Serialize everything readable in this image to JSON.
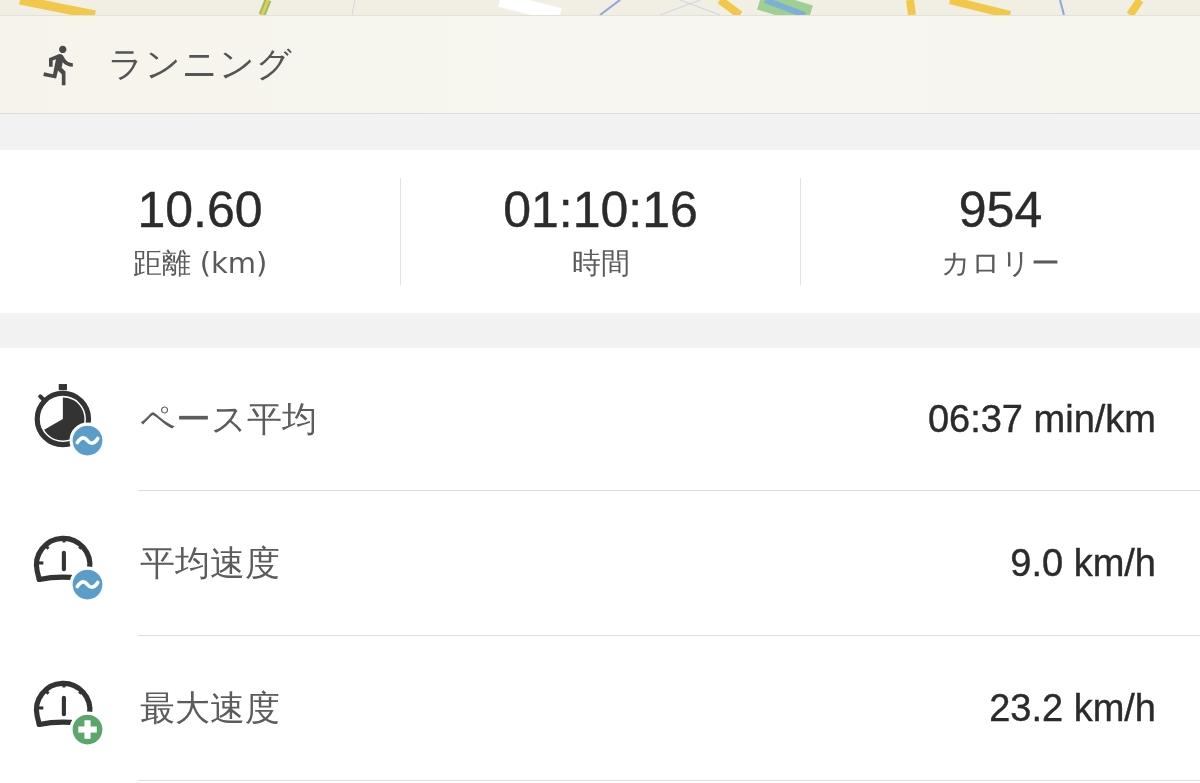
{
  "activity": {
    "title": "ランニング"
  },
  "summary": [
    {
      "value": "10.60",
      "label": "距離 (km)"
    },
    {
      "value": "01:10:16",
      "label": "時間"
    },
    {
      "value": "954",
      "label": "カロリー"
    }
  ],
  "metrics": [
    {
      "kind": "pace",
      "label": "ペース平均",
      "value": "06:37 min/km"
    },
    {
      "kind": "average",
      "label": "平均速度",
      "value": "9.0 km/h"
    },
    {
      "kind": "maximum",
      "label": "最大速度",
      "value": "23.2 km/h"
    }
  ]
}
